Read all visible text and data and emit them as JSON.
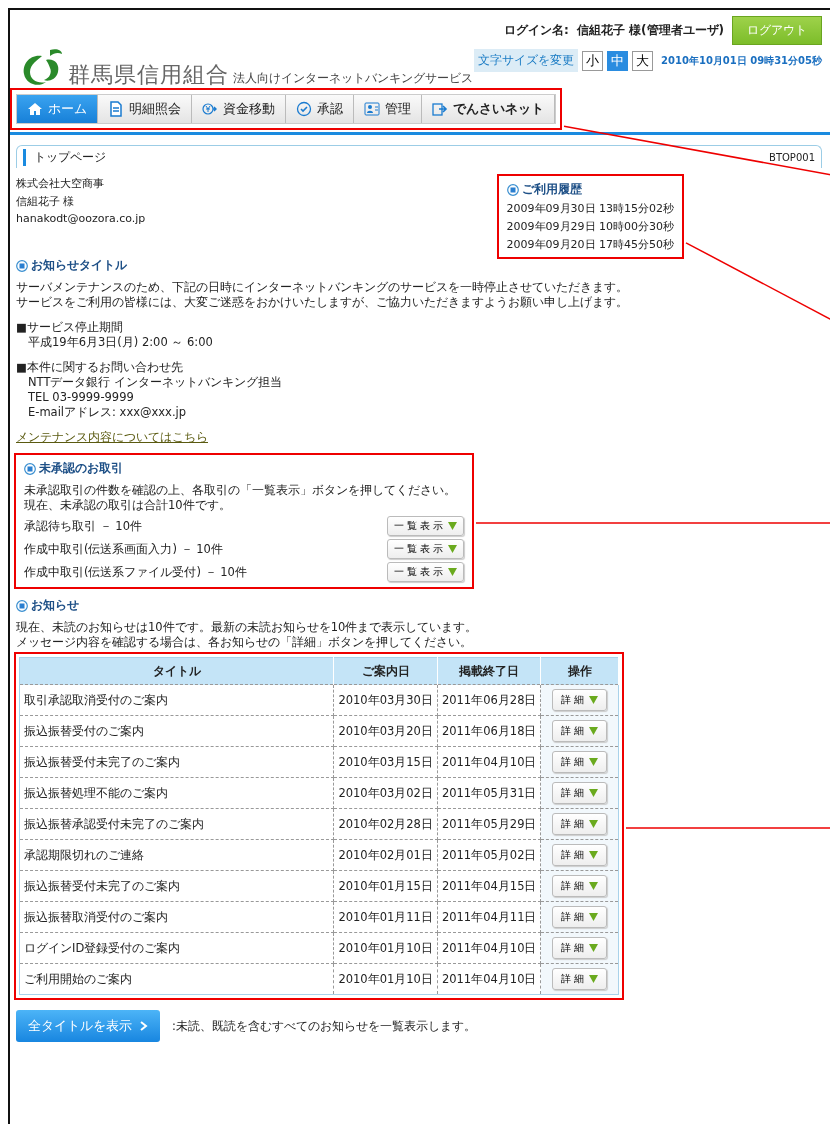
{
  "header": {
    "bank_name": "群馬県信用組合",
    "service_name": "法人向けインターネットバンキングサービス",
    "login_label": "ログイン名:",
    "login_user": "信組花子 様(管理者ユーザ)",
    "logout": "ログアウト",
    "font_size_label": "文字サイズを変更",
    "font_sizes": [
      {
        "label": "小",
        "selected": false
      },
      {
        "label": "中",
        "selected": true
      },
      {
        "label": "大",
        "selected": false
      }
    ],
    "datetime": "2010年10月01日 09時31分05秒"
  },
  "nav": {
    "highlighted": true,
    "tabs": [
      {
        "label": "ホーム",
        "selected": true
      },
      {
        "label": "明細照会",
        "selected": false
      },
      {
        "label": "資金移動",
        "selected": false
      },
      {
        "label": "承認",
        "selected": false
      },
      {
        "label": "管理",
        "selected": false
      },
      {
        "label": "でんさいネット",
        "selected": false
      }
    ]
  },
  "page": {
    "title": "トップページ",
    "screen_id": "BTOP001"
  },
  "user_info": [
    "株式会社大空商事",
    "信組花子 様",
    "hanakodt@oozora.co.jp"
  ],
  "history": {
    "highlighted": true,
    "title": "ご利用履歴",
    "entries": [
      "2009年09月30日 13時15分02秒",
      "2009年09月29日 10時00分30秒",
      "2009年09月20日 17時45分50秒"
    ]
  },
  "notice": {
    "title": "お知らせタイトル",
    "paragraphs": [
      [
        "サーバメンテナンスのため、下記の日時にインターネットバンキングのサービスを一時停止させていただきます。",
        "サービスをご利用の皆様には、大変ご迷惑をおかけいたしますが、ご協力いただきますようお願い申し上げます。"
      ],
      [
        "■サービス停止期間",
        "　平成19年6月3日(月) 2:00 ～ 6:00"
      ],
      [
        "■本件に関するお問い合わせ先",
        "　NTTデータ銀行 インターネットバンキング担当",
        "　TEL 03-9999-9999",
        "　E-mailアドレス: xxx@xxx.jp"
      ]
    ],
    "link": "メンテナンス内容についてはこちら"
  },
  "pending": {
    "highlighted": true,
    "title": "未承認のお取引",
    "description": [
      "未承認取引の件数を確認の上、各取引の「一覧表示」ボタンを押してください。",
      "現在、未承認の取引は合計10件です。"
    ],
    "items": [
      {
        "label": "承認待ち取引 － 10件",
        "button": "一覧表示"
      },
      {
        "label": "作成中取引(伝送系画面入力) － 10件",
        "button": "一覧表示"
      },
      {
        "label": "作成中取引(伝送系ファイル受付) － 10件",
        "button": "一覧表示"
      }
    ]
  },
  "news": {
    "title": "お知らせ",
    "description": [
      "現在、未読のお知らせは10件です。最新の未読お知らせを10件まで表示しています。",
      "メッセージ内容を確認する場合は、各お知らせの「詳細」ボタンを押してください。"
    ],
    "table": {
      "highlighted": true,
      "columns": [
        "タイトル",
        "ご案内日",
        "掲載終了日",
        "操作"
      ],
      "rows": [
        [
          "取引承認取消受付のご案内",
          "2010年03月30日",
          "2011年06月28日",
          "詳細"
        ],
        [
          "振込振替受付のご案内",
          "2010年03月20日",
          "2011年06月18日",
          "詳細"
        ],
        [
          "振込振替受付未完了のご案内",
          "2010年03月15日",
          "2011年04月10日",
          "詳細"
        ],
        [
          "振込振替処理不能のご案内",
          "2010年03月02日",
          "2011年05月31日",
          "詳細"
        ],
        [
          "振込振替承認受付未完了のご案内",
          "2010年02月28日",
          "2011年05月29日",
          "詳細"
        ],
        [
          "承認期限切れのご連絡",
          "2010年02月01日",
          "2011年05月02日",
          "詳細"
        ],
        [
          "振込振替受付未完了のご案内",
          "2010年01月15日",
          "2011年04月15日",
          "詳細"
        ],
        [
          "振込振替取消受付のご案内",
          "2010年01月11日",
          "2011年04月11日",
          "詳細"
        ],
        [
          "ログインID登録受付のご案内",
          "2010年01月10日",
          "2011年04月10日",
          "詳細"
        ],
        [
          "ご利用開始のご案内",
          "2010年01月10日",
          "2011年04月10日",
          "詳細"
        ]
      ]
    },
    "all_button": "全タイトルを表示",
    "all_note": ":未読、既読を含むすべてのお知らせを一覧表示します。"
  }
}
